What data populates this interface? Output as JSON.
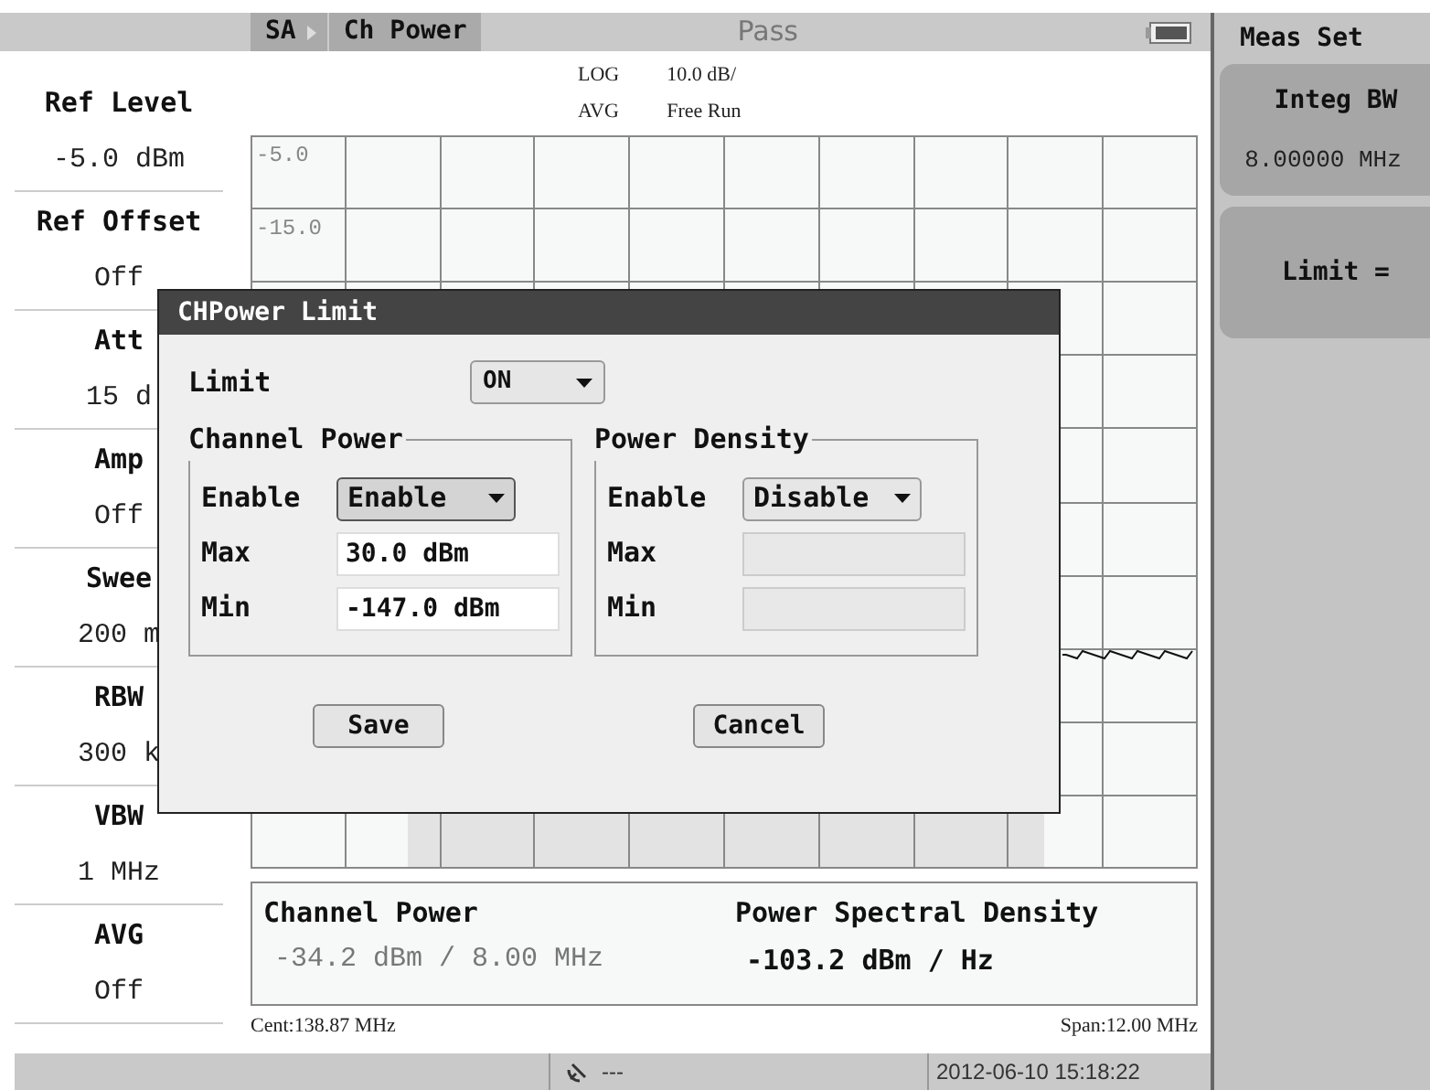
{
  "header": {
    "breadcrumb": [
      "SA",
      "Ch Power"
    ],
    "status": "Pass"
  },
  "trace_info": {
    "scale_type": "LOG",
    "detector": "AVG",
    "scale": "10.0 dB/",
    "trigger": "Free Run"
  },
  "sidebar": [
    {
      "label": "Ref Level",
      "value": "-5.0 dBm"
    },
    {
      "label": "Ref Offset",
      "value": "Off"
    },
    {
      "label": "Att",
      "value": "15 d"
    },
    {
      "label": "Amp",
      "value": "Off"
    },
    {
      "label": "Swee",
      "value": "200 m"
    },
    {
      "label": "RBW",
      "value": "300 k"
    },
    {
      "label": "VBW",
      "value": "1 MHz"
    },
    {
      "label": "AVG",
      "value": "Off"
    }
  ],
  "graph": {
    "scale_labels": [
      "-5.0",
      "-15.0"
    ]
  },
  "results": [
    {
      "label": "Channel Power",
      "value": "-34.2 dBm / 8.00 MHz",
      "selected": false
    },
    {
      "label": "Power Spectral Density",
      "value": "-103.2 dBm / Hz",
      "selected": true
    }
  ],
  "footer": {
    "center": "Cent:138.87 MHz",
    "span": "Span:12.00 MHz"
  },
  "status_bar": {
    "indicator": "---",
    "datetime": "2012-06-10 15:18:22"
  },
  "softkeys": {
    "title": "Meas Set",
    "items": [
      {
        "label": "Integ BW",
        "value": "8.00000 MHz"
      },
      {
        "label": "Limit ="
      }
    ]
  },
  "dialog": {
    "title": "CHPower Limit",
    "limit": {
      "label": "Limit",
      "value": "ON"
    },
    "groups": [
      {
        "title": "Channel Power",
        "enable": {
          "label": "Enable",
          "value": "Enable",
          "focused": true
        },
        "fields": [
          {
            "label": "Max",
            "value": "30.0 dBm",
            "disabled": false
          },
          {
            "label": "Min",
            "value": "-147.0 dBm",
            "disabled": false
          }
        ]
      },
      {
        "title": "Power Density",
        "enable": {
          "label": "Enable",
          "value": "Disable",
          "focused": false
        },
        "fields": [
          {
            "label": "Max",
            "disabled": true
          },
          {
            "label": "Min",
            "disabled": true
          }
        ]
      }
    ],
    "buttons": [
      "Save",
      "Cancel"
    ]
  }
}
